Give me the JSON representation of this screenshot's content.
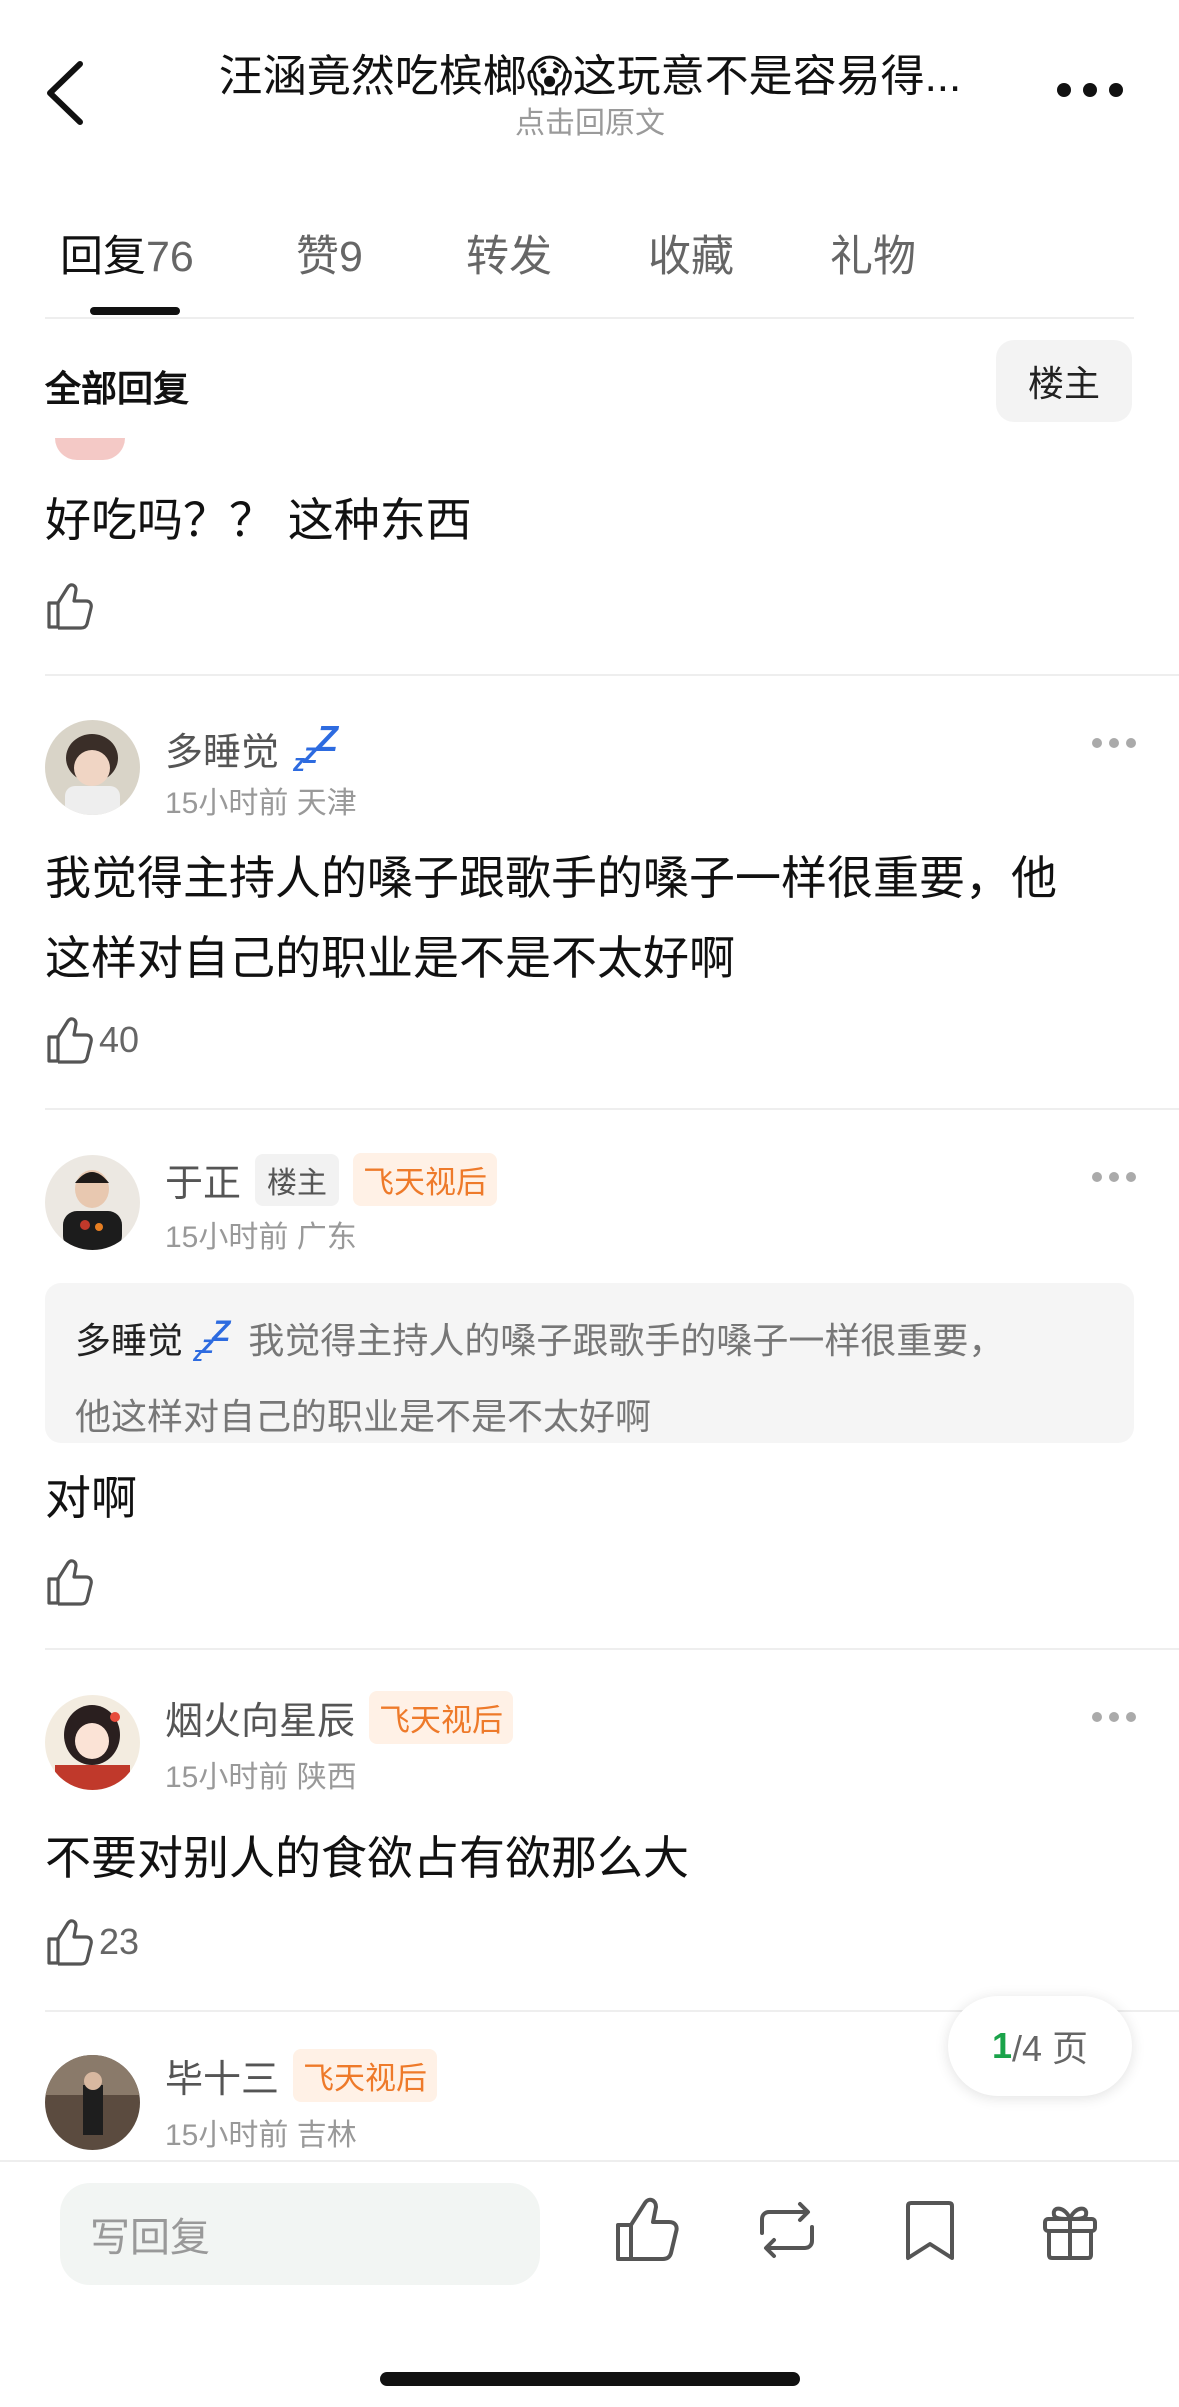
{
  "header": {
    "title": "汪涵竟然吃槟榔😱这玩意不是容易得...",
    "subtitle": "点击回原文"
  },
  "tabs": [
    {
      "label": "回复",
      "count": "76"
    },
    {
      "label": "赞",
      "count": "9"
    },
    {
      "label": "转发"
    },
    {
      "label": "收藏"
    },
    {
      "label": "礼物"
    }
  ],
  "filter": {
    "label": "全部回复",
    "owner_button": "楼主"
  },
  "comments": [
    {
      "text": "好吃吗？？ 这种东西"
    },
    {
      "user": "多睡觉",
      "time": "15小时前",
      "location": "天津",
      "text_line1": "我觉得主持人的嗓子跟歌手的嗓子一样很重要，他",
      "text_line2": "这样对自己的职业是不是不太好啊",
      "likes": "40"
    },
    {
      "user": "于正",
      "badge_owner": "楼主",
      "badge": "飞天视后",
      "time": "15小时前",
      "location": "广东",
      "quote_user": "多睡觉",
      "quote_line1": "我觉得主持人的嗓子跟歌手的嗓子一样很重要，",
      "quote_line2": "他这样对自己的职业是不是不太好啊",
      "text": "对啊"
    },
    {
      "user": "烟火向星辰",
      "badge": "飞天视后",
      "time": "15小时前",
      "location": "陕西",
      "text": "不要对别人的食欲占有欲那么大",
      "likes": "23"
    },
    {
      "user": "毕十三",
      "badge": "飞天视后",
      "time": "15小时前",
      "location": "吉林"
    }
  ],
  "pager": {
    "current": "1",
    "total": "/4 页"
  },
  "bottom": {
    "reply_placeholder": "写回复"
  },
  "colors": {
    "accent_green": "#1aa34a",
    "badge_orange": "#ee7a2a",
    "zzz_blue": "#2d6be0"
  },
  "icons": [
    "back-arrow-icon",
    "more-icon",
    "thumbs-up-icon",
    "repost-icon",
    "bookmark-icon",
    "gift-icon"
  ]
}
